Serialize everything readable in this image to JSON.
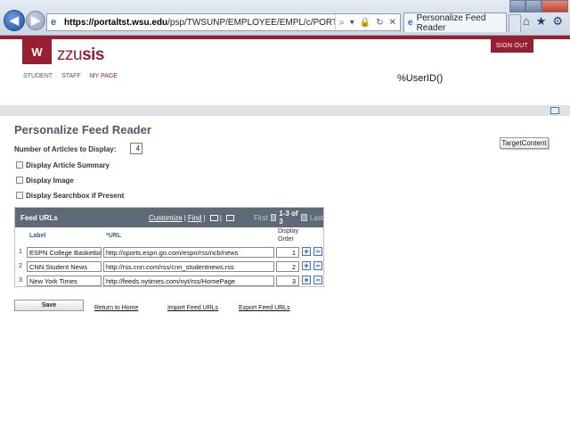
{
  "browser": {
    "url_bold": "https://portaltst.wsu.edu",
    "url_rest": "/psp/TWSUNP/EMPLOYEE/EMPL/c/PORTAL_COMPONENTS.EO_",
    "tab_title": "Personalize Feed Reader",
    "ie_glyph": "e",
    "tools": [
      "⌕",
      "▾",
      "🔒",
      "↻",
      "✕"
    ],
    "right_icons": [
      "⌂",
      "★",
      "⚙"
    ],
    "back_glyph": "◀",
    "fwd_glyph": "▶"
  },
  "header": {
    "logo_glyph": "W",
    "brand_prefix": "zzu",
    "brand_suffix": "sis",
    "sign_out": "SIGN OUT",
    "nav": [
      "STUDENT",
      "STAFF",
      "MY PAGE"
    ],
    "user_id": "%UserID()"
  },
  "page": {
    "title": "Personalize Feed Reader",
    "target_content": "TargetContent",
    "articles_label": "Number of Articles to Display:",
    "articles_value": "4",
    "options": [
      {
        "label": "Display Article Summary",
        "checked": false
      },
      {
        "label": "Display Image",
        "checked": false
      },
      {
        "label": "Display Searchbox if Present",
        "checked": false
      }
    ]
  },
  "grid": {
    "title": "Feed URLs",
    "customize": "Customize",
    "find": "Find",
    "first": "First",
    "range": "1-3 of 3",
    "last": "Last",
    "col_label": "Label",
    "col_url": "*URL",
    "col_order_1": "Display",
    "col_order_2": "Order",
    "add_glyph": "+",
    "remove_glyph": "−",
    "rows": [
      {
        "n": "1",
        "label": "ESPN College Basketba",
        "url": "http://sports.espn.go.com/espn/rss/ncb/news",
        "order": "1"
      },
      {
        "n": "2",
        "label": "CNN Student News",
        "url": "http://rss.cnn.com/rss/cnn_studentnews.rss",
        "order": "2"
      },
      {
        "n": "3",
        "label": "New York Times",
        "url": "http://feeds.nytimes.com/nyt/rss/HomePage",
        "order": "3"
      }
    ]
  },
  "footer": {
    "save": "Save",
    "return_home": "Return to Home",
    "import": "Import Feed URLs",
    "export": "Export Feed URLs"
  },
  "colors": {
    "brand": "#981e32",
    "grid_header": "#5e6a78"
  }
}
